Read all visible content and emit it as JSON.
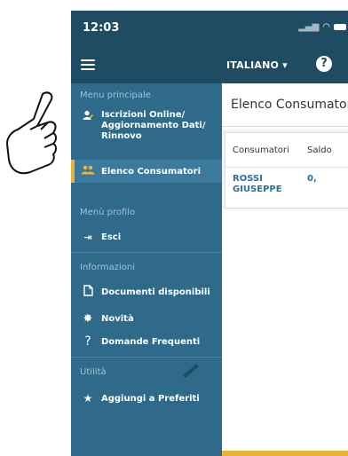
{
  "status_bar": {
    "time": "12:03"
  },
  "app_bar": {
    "language": "ITALIANO",
    "language_caret": "▾",
    "help": "?"
  },
  "sidebar": {
    "sections": [
      {
        "title": "Menu principale"
      },
      {
        "title": "Menù profilo"
      },
      {
        "title": "Informazioni"
      },
      {
        "title": "Utilità"
      }
    ],
    "items": {
      "iscrizioni": "Iscrizioni Online/ Aggiornamento Dati/ Rinnovo",
      "consumatori": "Elenco Consumatori",
      "esci": "Esci",
      "documenti": "Documenti disponibili",
      "novita": "Novità",
      "domande": "Domande Frequenti",
      "preferiti": "Aggiungi a Preferiti"
    }
  },
  "content": {
    "title": "Elenco Consumatori",
    "table": {
      "headers": [
        "Consumatori",
        "Saldo"
      ],
      "rows": [
        {
          "name": "ROSSI GIUSEPPE",
          "value": "0,"
        }
      ]
    }
  },
  "colors": {
    "header": "#1f4b63",
    "sidebar": "#2f6a8a",
    "accent": "#e7b33a",
    "link": "#2d6f99"
  }
}
